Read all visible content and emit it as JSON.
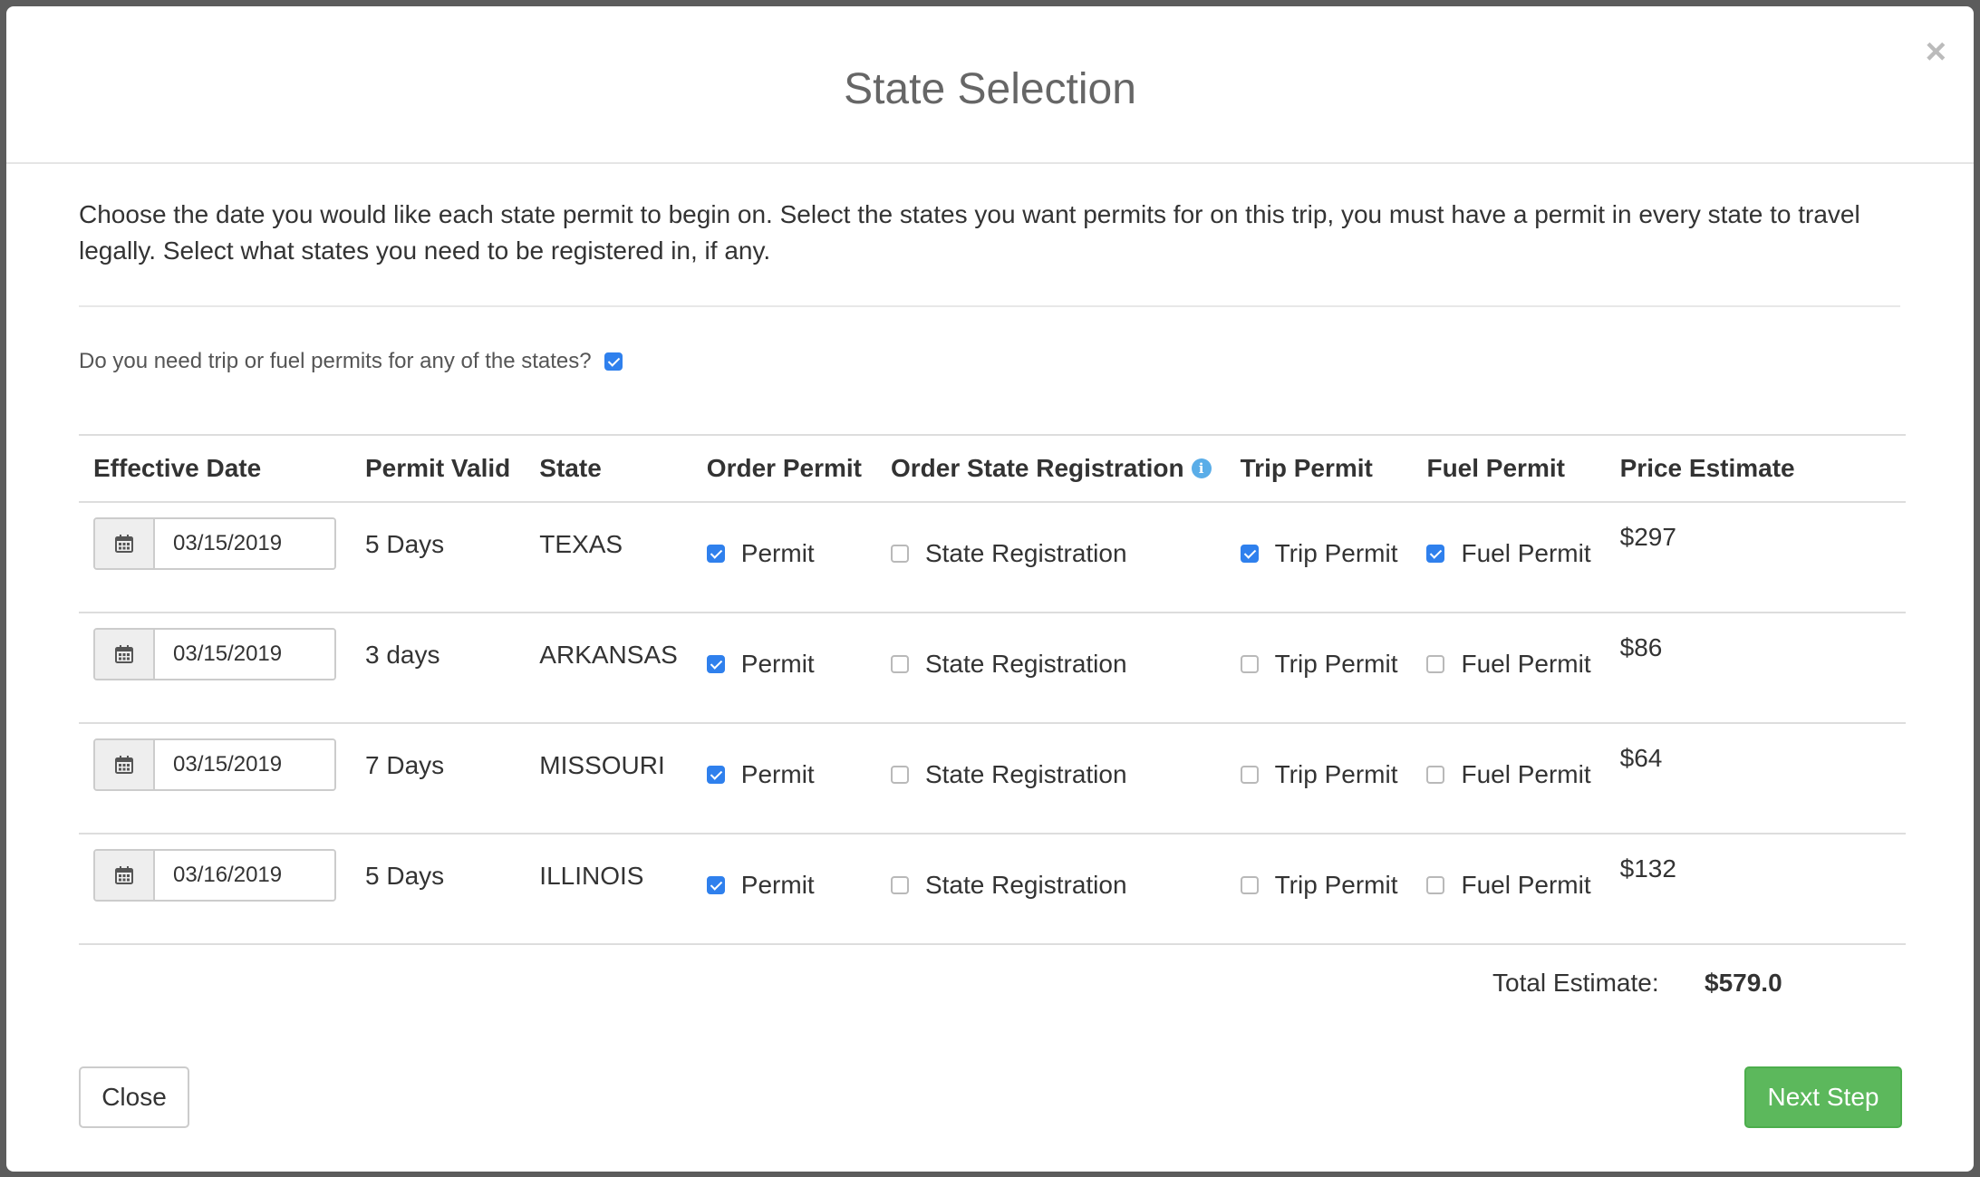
{
  "modal": {
    "title": "State Selection",
    "close_glyph": "×",
    "intro": "Choose the date you would like each state permit to begin on. Select the states you want permits for on this trip, you must have a permit in every state to travel legally. Select what states you need to be registered in, if any.",
    "question": "Do you need trip or fuel permits for any of the states?",
    "question_checked": true
  },
  "table": {
    "headers": {
      "effective_date": "Effective Date",
      "permit_valid": "Permit Valid",
      "state": "State",
      "order_permit": "Order Permit",
      "order_state_registration": "Order State Registration",
      "trip_permit": "Trip Permit",
      "fuel_permit": "Fuel Permit",
      "price_estimate": "Price Estimate"
    },
    "option_labels": {
      "permit": "Permit",
      "state_registration": "State Registration",
      "trip_permit": "Trip Permit",
      "fuel_permit": "Fuel Permit"
    },
    "rows": [
      {
        "date": "03/15/2019",
        "valid": "5 Days",
        "state": "TEXAS",
        "permit": true,
        "registration": false,
        "trip": true,
        "fuel": true,
        "price": "$297"
      },
      {
        "date": "03/15/2019",
        "valid": "3 days",
        "state": "ARKANSAS",
        "permit": true,
        "registration": false,
        "trip": false,
        "fuel": false,
        "price": "$86"
      },
      {
        "date": "03/15/2019",
        "valid": "7 Days",
        "state": "MISSOURI",
        "permit": true,
        "registration": false,
        "trip": false,
        "fuel": false,
        "price": "$64"
      },
      {
        "date": "03/16/2019",
        "valid": "5 Days",
        "state": "ILLINOIS",
        "permit": true,
        "registration": false,
        "trip": false,
        "fuel": false,
        "price": "$132"
      }
    ]
  },
  "total": {
    "label": "Total Estimate:",
    "value": "$579.0"
  },
  "buttons": {
    "close": "Close",
    "next": "Next Step"
  },
  "colors": {
    "accent_checkbox": "#2f80ed",
    "primary_button": "#5cb85c",
    "info_icon": "#5aade8"
  },
  "icons": {
    "date_addon": "calendar-icon",
    "header_info": "info-icon",
    "dismiss": "close-icon"
  }
}
